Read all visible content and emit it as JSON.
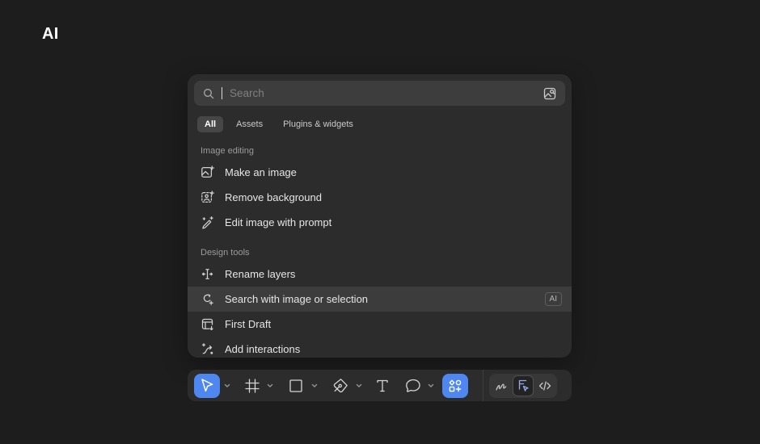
{
  "page": {
    "title": "AI",
    "background": "#1d1d1d"
  },
  "palette": {
    "panel_bg": "#2c2c2c",
    "input_bg": "#3d3d3d",
    "highlight_bg": "#3c3c3c",
    "accent_blue": "#4e87f0",
    "dev_icon_color": "#9aa8f0"
  },
  "search_panel": {
    "search_placeholder": "Search",
    "visual_search_icon": "image-search-icon",
    "tabs": [
      {
        "label": "All",
        "selected": true
      },
      {
        "label": "Assets",
        "selected": false
      },
      {
        "label": "Plugins & widgets",
        "selected": false
      }
    ],
    "sections": [
      {
        "title": "Image editing",
        "items": [
          {
            "label": "Make an image",
            "icon": "image-sparkle-icon"
          },
          {
            "label": "Remove background",
            "icon": "remove-background-icon"
          },
          {
            "label": "Edit image with prompt",
            "icon": "magic-pen-icon"
          }
        ]
      },
      {
        "title": "Design tools",
        "items": [
          {
            "label": "Rename layers",
            "icon": "rename-layers-icon"
          },
          {
            "label": "Search with image or selection",
            "icon": "scan-search-icon",
            "badge": "AI",
            "highlighted": true
          },
          {
            "label": "First Draft",
            "icon": "first-draft-icon"
          },
          {
            "label": "Add interactions",
            "icon": "interactions-icon"
          }
        ]
      }
    ]
  },
  "toolbar": {
    "left_tools": [
      "move-tool",
      "frame-tool",
      "rectangle-tool",
      "pen-tool",
      "text-tool",
      "comment-tool",
      "actions-button"
    ],
    "right_tools": [
      "draw-tool",
      "dev-mode-toggle",
      "code-view"
    ],
    "selected_tool": "move-tool",
    "selected_right_tool": "dev-mode-toggle"
  }
}
